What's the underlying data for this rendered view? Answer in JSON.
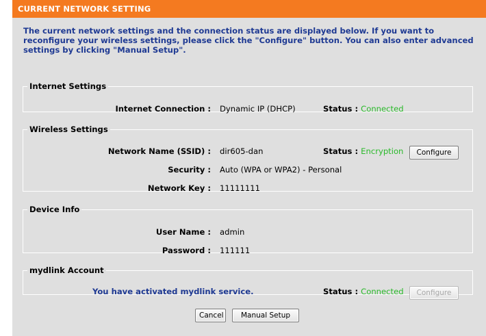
{
  "header": {
    "title": "CURRENT NETWORK SETTING"
  },
  "intro": "The current network settings and the connection status are displayed below. If you want to reconfigure your wireless settings, please click the \"Configure\" button. You can also enter advanced settings by clicking \"Manual Setup\".",
  "internet": {
    "legend": "Internet Settings",
    "connection_label": "Internet Connection :",
    "connection_value": "Dynamic IP (DHCP)",
    "status_label": "Status :",
    "status_value": "Connected"
  },
  "wireless": {
    "legend": "Wireless Settings",
    "ssid_label": "Network Name (SSID) :",
    "ssid_value": "dir605-dan",
    "status_label": "Status :",
    "status_value": "Encryption",
    "configure_label": "Configure",
    "security_label": "Security :",
    "security_value": "Auto (WPA or WPA2) - Personal",
    "key_label": "Network Key :",
    "key_value": "11111111"
  },
  "device": {
    "legend": "Device Info",
    "user_label": "User Name :",
    "user_value": "admin",
    "password_label": "Password :",
    "password_value": "111111"
  },
  "mydlink": {
    "legend": "mydlink Account",
    "message": "You have activated mydlink service.",
    "status_label": "Status :",
    "status_value": "Connected",
    "configure_label": "Configure"
  },
  "buttons": {
    "cancel": "Cancel",
    "manual_setup": "Manual Setup"
  },
  "colors": {
    "header_bg": "#f47a20",
    "panel_bg": "#dfdfdf",
    "intro_text": "#1f3a93",
    "status_green": "#2ab92a"
  }
}
